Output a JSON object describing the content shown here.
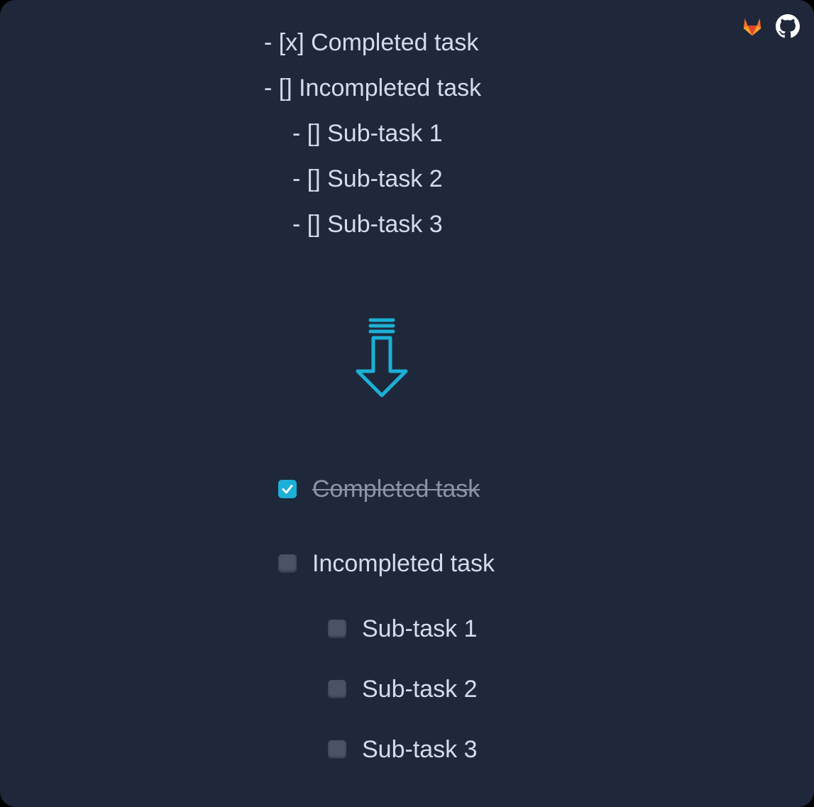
{
  "header": {
    "icons": [
      {
        "name": "gitlab-icon",
        "color": "#fc6d26"
      },
      {
        "name": "github-icon",
        "color": "#ffffff"
      }
    ]
  },
  "markdown_source": {
    "lines": [
      "- [x] Completed task",
      "- [] Incompleted task",
      "- [] Sub-task 1",
      "- [] Sub-task 2",
      "- [] Sub-task 3"
    ]
  },
  "arrow": {
    "icon": "arrow-down-icon",
    "color": "#1cb0d6"
  },
  "rendered": {
    "tasks": [
      {
        "label": "Completed task",
        "checked": true
      },
      {
        "label": "Incompleted task",
        "checked": false
      },
      {
        "label": "Sub-task 1",
        "checked": false
      },
      {
        "label": "Sub-task 2",
        "checked": false
      },
      {
        "label": "Sub-task 3",
        "checked": false
      }
    ]
  },
  "colors": {
    "background": "#1e283a",
    "text": "#d4dceb",
    "accent": "#1cb0d6",
    "unchecked_box": "#4a5366"
  }
}
